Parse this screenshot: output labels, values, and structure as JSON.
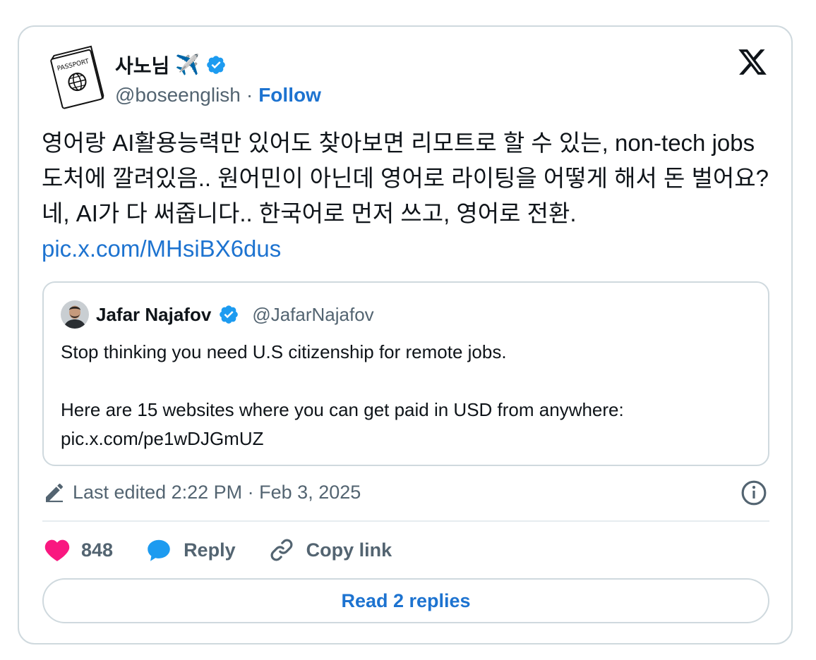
{
  "author": {
    "display_name": "사노님",
    "plane_emoji": "✈️",
    "handle": "@boseenglish",
    "separator": "·",
    "follow_label": "Follow",
    "avatar_text": "PASSPORT"
  },
  "tweet": {
    "text": "영어랑 AI활용능력만 있어도 찾아보면 리모트로 할 수 있는, non-tech jobs 도처에 깔려있음.. 원어민이 아닌데 영어로 라이팅을 어떻게 해서 돈 벌어요? 네, AI가 다 써줍니다.. 한국어로 먼저 쓰고, 영어로 전환.",
    "link": "pic.x.com/MHsiBX6dus"
  },
  "quote": {
    "name": "Jafar Najafov",
    "handle": "@JafarNajafov",
    "line1": "Stop thinking you need U.S citizenship for remote jobs.",
    "line2": "Here are 15 websites where you can get paid in USD from anywhere:",
    "link": "pic.x.com/pe1wDJGmUZ"
  },
  "meta": {
    "edited_text": "Last edited 2:22 PM · Feb 3, 2025"
  },
  "actions": {
    "like_count": "848",
    "reply_label": "Reply",
    "copy_label": "Copy link"
  },
  "footer": {
    "read_replies_label": "Read 2 replies"
  },
  "colors": {
    "link": "#1d73d0",
    "verified": "#1d9bf0",
    "like": "#f91880",
    "muted": "#536471",
    "border": "#cfd9de"
  },
  "icons": [
    "passport-avatar-icon",
    "verified-badge-icon",
    "x-logo-icon",
    "pencil-icon",
    "info-icon",
    "heart-icon",
    "reply-bubble-icon",
    "link-icon"
  ]
}
